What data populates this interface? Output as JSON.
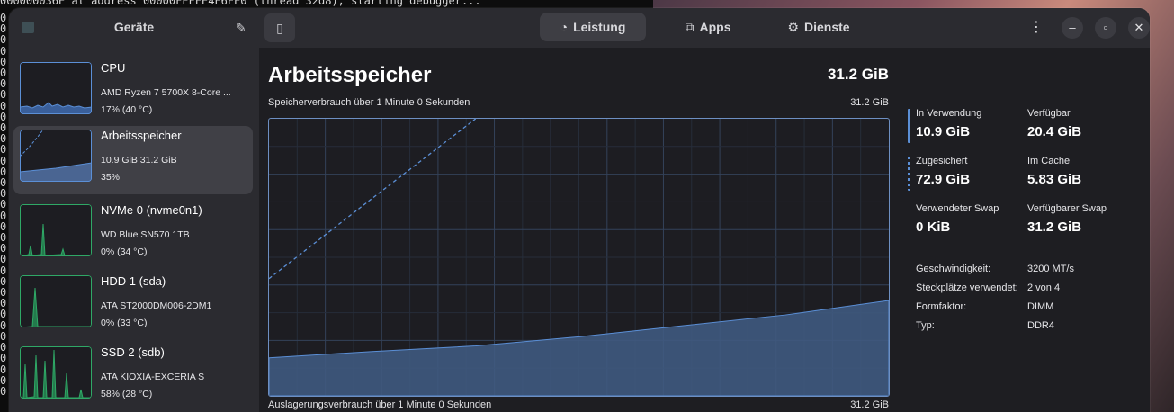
{
  "terminal": {
    "top_line": "000000036E at address 00000FFFFE4F6FE0 (thread 32d8), starting debugger...",
    "column_glyph": "0"
  },
  "sidebar": {
    "title": "Geräte",
    "devices": [
      {
        "name": "CPU",
        "line1": "AMD Ryzen 7 5700X 8-Core ...",
        "line2": "17% (40 °C)",
        "color": "#5b8fd6",
        "selected": false
      },
      {
        "name": "Arbeitsspeicher",
        "line1": "10.9 GiB 31.2 GiB",
        "line2": "35%",
        "color": "#5b8fd6",
        "selected": true
      },
      {
        "name": "NVMe 0 (nvme0n1)",
        "line1": "WD Blue SN570 1TB",
        "line2": "0% (34 °C)",
        "color": "#2fa866",
        "selected": false
      },
      {
        "name": "HDD 1 (sda)",
        "line1": "ATA ST2000DM006-2DM1",
        "line2": "0% (33 °C)",
        "color": "#2fa866",
        "selected": false
      },
      {
        "name": "SSD 2 (sdb)",
        "line1": "ATA KIOXIA-EXCERIA S",
        "line2": "58% (28 °C)",
        "color": "#2fa866",
        "selected": false
      }
    ]
  },
  "tabs": [
    {
      "label": "Leistung",
      "icon": "gauge-icon",
      "active": true
    },
    {
      "label": "Apps",
      "icon": "apps-icon",
      "active": false
    },
    {
      "label": "Dienste",
      "icon": "gear-icon",
      "active": false
    }
  ],
  "main": {
    "title": "Arbeitsspeicher",
    "total": "31.2 GiB",
    "usage_graph_label": "Speicherverbrauch über 1 Minute 0 Sekunden",
    "usage_graph_max": "31.2 GiB",
    "swap_graph_label": "Auslagerungsverbrauch über 1 Minute 0 Sekunden",
    "swap_graph_max": "31.2 GiB"
  },
  "chart_data": {
    "type": "area",
    "x": [
      0,
      10,
      20,
      30,
      40,
      50,
      60
    ],
    "series": [
      {
        "values": [
          0.137,
          0.16,
          0.18,
          0.213,
          0.253,
          0.292,
          0.344
        ],
        "color": "#5b8fd6",
        "style": "solid-fill"
      },
      {
        "values": [
          0.423,
          0.713,
          1.0
        ],
        "color": "#5b8fd6",
        "style": "dashed"
      }
    ],
    "ylim": [
      0,
      1
    ],
    "grid": true,
    "accent_color": "#5b8fd6"
  },
  "stats": {
    "in_use_label": "In Verwendung",
    "in_use_value": "10.9 GiB",
    "available_label": "Verfügbar",
    "available_value": "20.4 GiB",
    "committed_label": "Zugesichert",
    "committed_value": "72.9 GiB",
    "cached_label": "Im Cache",
    "cached_value": "5.83 GiB",
    "swap_used_label": "Verwendeter Swap",
    "swap_used_value": "0 KiB",
    "swap_avail_label": "Verfügbarer Swap",
    "swap_avail_value": "31.2 GiB",
    "details": [
      {
        "key": "Geschwindigkeit:",
        "value": "3200 MT/s"
      },
      {
        "key": "Steckplätze verwendet:",
        "value": "2 von 4"
      },
      {
        "key": "Formfaktor:",
        "value": "DIMM"
      },
      {
        "key": "Typ:",
        "value": "DDR4"
      }
    ]
  }
}
